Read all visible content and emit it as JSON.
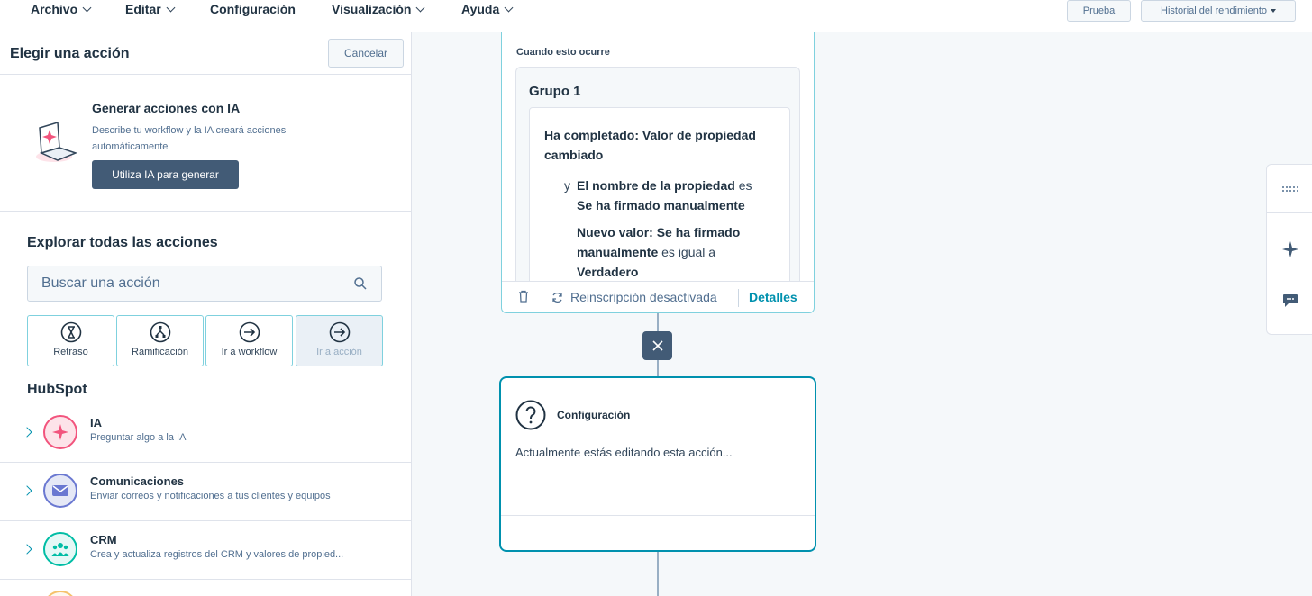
{
  "menu": {
    "items": [
      "Archivo",
      "Editar",
      "Configuración",
      "Visualización",
      "Ayuda"
    ],
    "test_button": "Prueba",
    "history_button": "Historial del rendimiento"
  },
  "panel": {
    "title": "Elegir una acción",
    "cancel": "Cancelar",
    "ai": {
      "title": "Generar acciones con IA",
      "description": "Describe tu workflow y la IA creará acciones automáticamente",
      "button": "Utiliza IA para generar"
    },
    "explore_title": "Explorar todas las acciones",
    "search_placeholder": "Buscar una acción",
    "quick_actions": [
      {
        "label": "Retraso",
        "icon": "hourglass-icon"
      },
      {
        "label": "Ramificación",
        "icon": "branch-icon"
      },
      {
        "label": "Ir a workflow",
        "icon": "arrow-circle-icon"
      },
      {
        "label": "Ir a acción",
        "icon": "arrow-circle-icon"
      }
    ],
    "hubspot_title": "HubSpot",
    "categories": [
      {
        "name": "IA",
        "description": "Preguntar algo a la IA",
        "icon": "sparkle-icon",
        "color": "#f2547d"
      },
      {
        "name": "Comunicaciones",
        "description": "Enviar correos y notificaciones a tus clientes y equipos",
        "icon": "envelope-icon",
        "color": "#6a78d1"
      },
      {
        "name": "CRM",
        "description": "Crea y actualiza registros del CRM y valores de propied...",
        "icon": "people-icon",
        "color": "#00bda5"
      }
    ]
  },
  "trigger": {
    "label": "Cuando esto ocurre",
    "group_title": "Grupo 1",
    "main_condition": "Ha completado: Valor de propiedad cambiado",
    "connector": "y",
    "prop_name_bold": "El nombre de la propiedad",
    "prop_name_rest": " es",
    "prop_value": "Se ha firmado manualmente",
    "new_value_bold": "Nuevo valor: Se ha firmado manualmente",
    "new_value_rest": " es igual a",
    "new_value_value": "Verdadero",
    "reenroll": "Reinscripción desactivada",
    "details": "Detalles"
  },
  "action": {
    "title": "Configuración",
    "text": "Actualmente estás editando esta acción..."
  },
  "colors": {
    "accent": "#0091ae",
    "dark_button": "#425b76",
    "border": "#dfe3eb"
  }
}
